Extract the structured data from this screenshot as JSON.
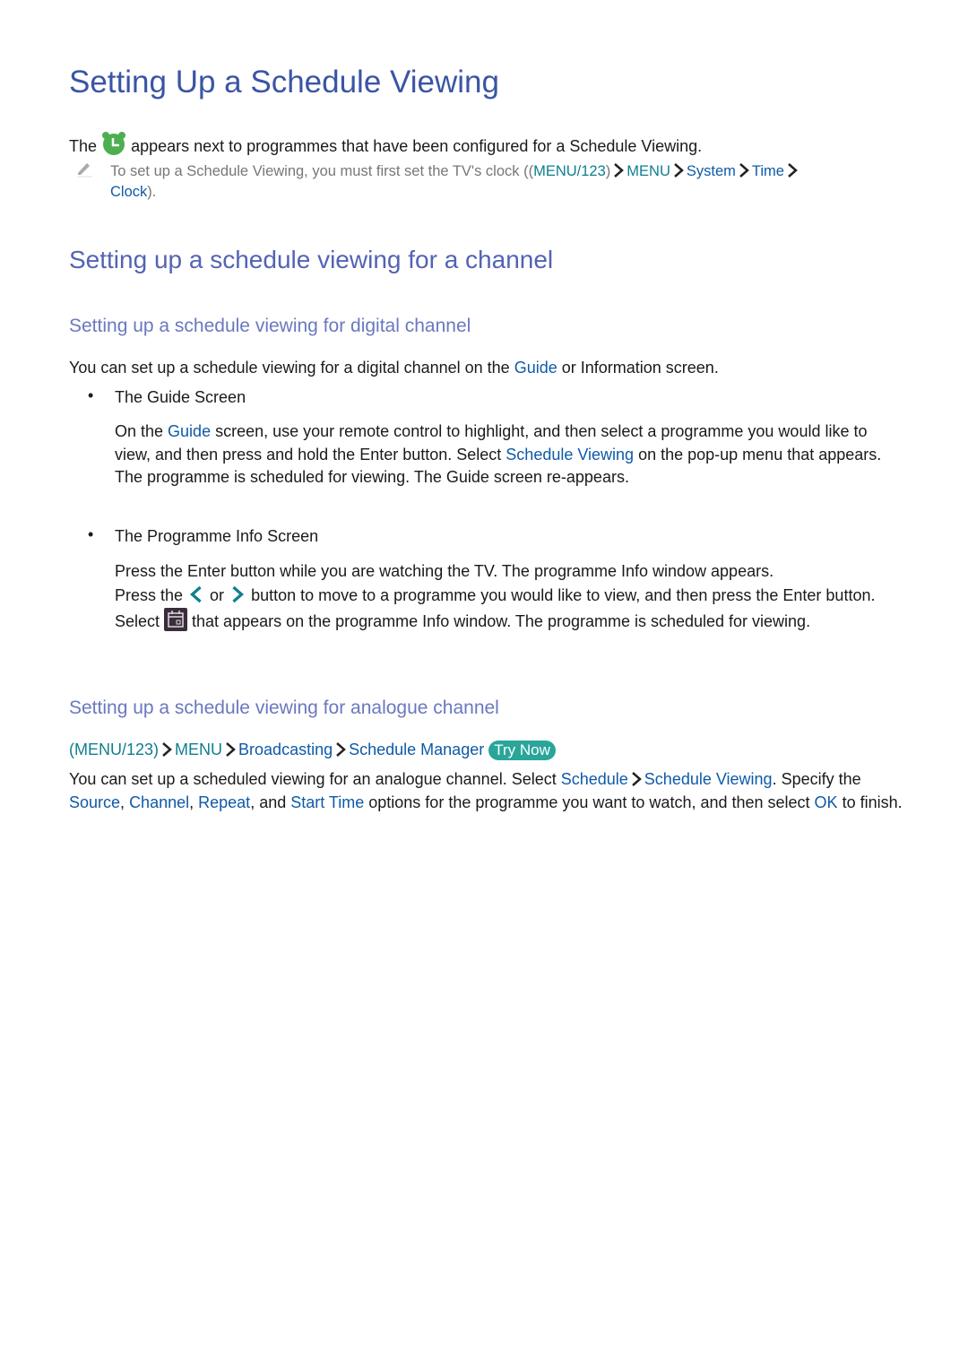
{
  "title": "Setting Up a Schedule Viewing",
  "intro": {
    "before": "The",
    "icon": "alarm-clock-icon",
    "after": "appears next to programmes that have been configured for a Schedule Viewing."
  },
  "note": {
    "icon": "pencil-icon",
    "text": "To set up a Schedule Viewing, you must first set the TV's clock ((",
    "path": [
      "MENU/123",
      "MENU",
      "System",
      "Time",
      "Clock"
    ],
    "end": ")."
  },
  "section": {
    "title": "Setting up a schedule viewing for a channel",
    "digital": {
      "title": "Setting up a schedule viewing for digital channel",
      "intro_pre": "You can set up a schedule viewing for a digital channel on the ",
      "intro_link": "Guide",
      "intro_post": " or Information screen.",
      "items": [
        {
          "heading": "The Guide Screen",
          "p1": "On the ",
          "link1": "Guide",
          "p2": " screen, use your remote control to highlight, and then select a programme you would like to view, and then press and hold the Enter button. Select ",
          "link2": "Schedule Viewing",
          "p3": " on the pop-up menu that appears. The programme is scheduled for viewing. The Guide screen re-appears."
        },
        {
          "heading": "The Programme Info Screen",
          "line1": "Press the Enter button while you are watching the TV. The programme Info window appears.",
          "p1": "Press the ",
          "left_icon": "chevron-left-icon",
          "or": " or ",
          "right_icon": "chevron-right-icon",
          "p2": " button to move to a programme you would like to view, and then press the Enter button. Select ",
          "cal_icon": "calendar-icon",
          "p3": " that appears on the programme Info window. The programme is scheduled for viewing."
        }
      ]
    },
    "analogue": {
      "title": "Setting up a schedule viewing for analogue channel",
      "path": [
        "(MENU/123)",
        "MENU",
        "Broadcasting",
        "Schedule Manager"
      ],
      "try_now": "Try Now",
      "t1": "You can set up a scheduled viewing for an analogue channel. Select ",
      "l1": "Schedule",
      "l2": "Schedule Viewing",
      "t2": ". Specify the ",
      "l3": "Source",
      "t3": ", ",
      "l4": "Channel",
      "t4": ", ",
      "l5": "Repeat",
      "t5": ", and ",
      "l6": "Start Time",
      "t6": " options for the programme you want to watch, and then select ",
      "l7": "OK",
      "t7": " to finish."
    }
  },
  "colors": {
    "title": "#3a55a4",
    "h2": "#5363b5",
    "h3": "#6a78bf",
    "link_blue": "#0e5aa7",
    "link_teal": "#0f7e8f",
    "try_now_bg": "#2aa59a",
    "clock_green": "#4caf50"
  }
}
